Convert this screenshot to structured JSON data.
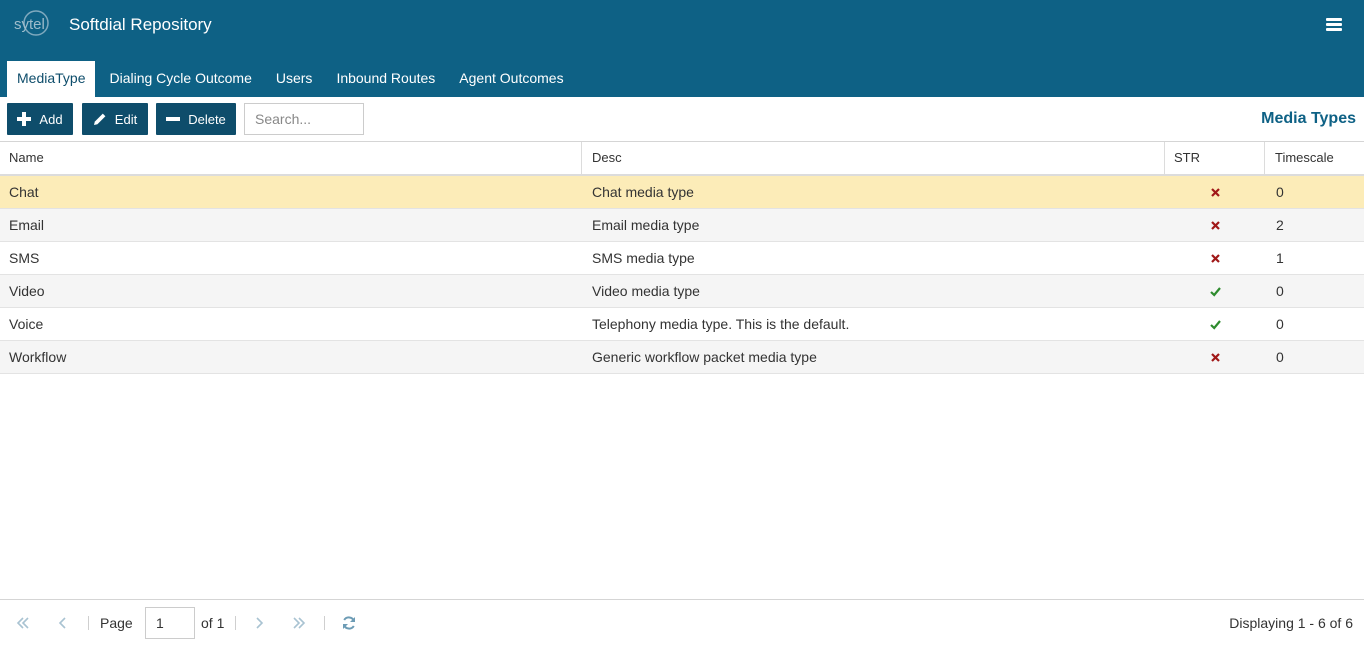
{
  "app": {
    "logo_text": "sytel",
    "title": "Softdial Repository"
  },
  "tabs": [
    {
      "label": "MediaType",
      "active": true
    },
    {
      "label": "Dialing Cycle Outcome",
      "active": false
    },
    {
      "label": "Users",
      "active": false
    },
    {
      "label": "Inbound Routes",
      "active": false
    },
    {
      "label": "Agent Outcomes",
      "active": false
    }
  ],
  "toolbar": {
    "add_label": "Add",
    "edit_label": "Edit",
    "delete_label": "Delete",
    "search_placeholder": "Search...",
    "heading": "Media Types"
  },
  "grid": {
    "columns": [
      "Name",
      "Desc",
      "STR",
      "Timescale"
    ],
    "rows": [
      {
        "name": "Chat",
        "desc": "Chat media type",
        "str": false,
        "timescale": "0",
        "selected": true
      },
      {
        "name": "Email",
        "desc": "Email media type",
        "str": false,
        "timescale": "2"
      },
      {
        "name": "SMS",
        "desc": "SMS media type",
        "str": false,
        "timescale": "1"
      },
      {
        "name": "Video",
        "desc": "Video media type",
        "str": true,
        "timescale": "0"
      },
      {
        "name": "Voice",
        "desc": "Telephony media type. This is the default.",
        "str": true,
        "timescale": "0"
      },
      {
        "name": "Workflow",
        "desc": "Generic workflow packet media type",
        "str": false,
        "timescale": "0"
      }
    ]
  },
  "pager": {
    "page_label": "Page",
    "page_value": "1",
    "of_label": "of 1",
    "display_info": "Displaying 1 - 6 of 6"
  },
  "colors": {
    "header": "#0e6185",
    "button": "#0e4d6b",
    "selected_row": "#fcecb8",
    "check": "#2e8b2e",
    "cross": "#a01818",
    "pager_icon": "#a9c3d2"
  }
}
